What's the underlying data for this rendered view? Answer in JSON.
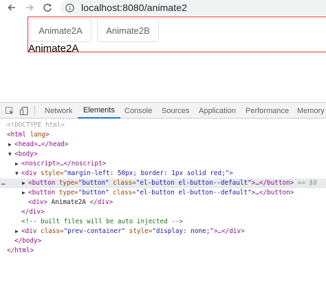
{
  "browser": {
    "url": "localhost:8080/animate2"
  },
  "page": {
    "button_a": "Animate2A",
    "button_b": "Animate2B",
    "text": "Animate2A"
  },
  "devtools": {
    "tabs": [
      "Network",
      "Elements",
      "Console",
      "Sources",
      "Application",
      "Performance",
      "Memory"
    ],
    "active_tab": "Elements",
    "lines": {
      "l0": "<!DOCTYPE html>",
      "l1a": "<html",
      "l1b": " lang",
      "l1c": ">",
      "l2": "<head>…</head>",
      "l3": "<body>",
      "l4": "<noscript>…</noscript>",
      "l5a": "<div",
      "l5b": " style=",
      "l5c": "\"margin-left: 50px; border: 1px solid red;\"",
      "l5d": ">",
      "l6a": "<button",
      "l6b": " type=",
      "l6c": "\"button\"",
      "l6d": " class=",
      "l6e": "\"el-button el-button--default\"",
      "l6f": ">…</button>",
      "l6g": " == $0",
      "l7a": "<button",
      "l7b": " type=",
      "l7c": "\"button\"",
      "l7d": " class=",
      "l7e": "\"el-button el-button--default\"",
      "l7f": ">…</button>",
      "l8a": "<div>",
      "l8b": " Animate2A ",
      "l8c": "</div>",
      "l9": "</div>",
      "l10": "<!-- built files will be auto injected -->",
      "l11a": "<div",
      "l11b": " class=",
      "l11c": "\"prev-container\"",
      "l11d": " style=",
      "l11e": "\"display: none;\"",
      "l11f": ">…</div>",
      "l12": "</body>",
      "l13": "</html>",
      "row_dots": "…"
    }
  },
  "colors": {
    "accent": "#1a73e8",
    "tag": "#881280",
    "attr": "#994500",
    "value": "#1a1aa6",
    "comment": "#236e25",
    "red_border": "#e83838"
  }
}
